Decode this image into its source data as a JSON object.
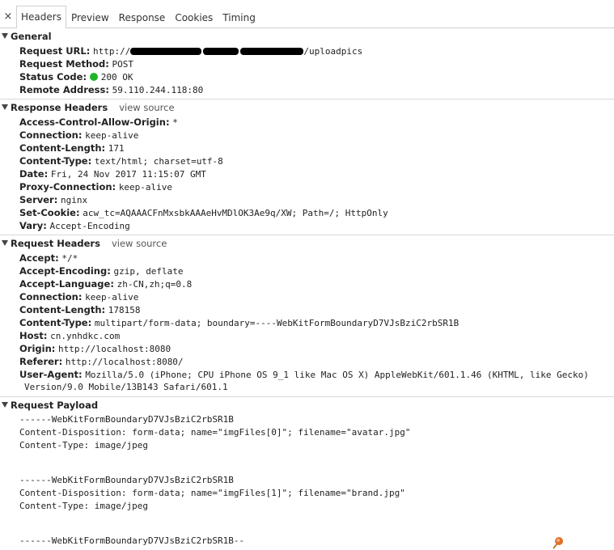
{
  "tabs": {
    "close": "×",
    "items": [
      "Headers",
      "Preview",
      "Response",
      "Cookies",
      "Timing"
    ]
  },
  "general": {
    "title": "General",
    "request_url_key": "Request URL:",
    "request_url_prefix": "http://",
    "request_url_suffix": "/uploadpics",
    "request_method_key": "Request Method:",
    "request_method": "POST",
    "status_code_key": "Status Code:",
    "status_code": "200 OK",
    "status_color": "#1db62a",
    "remote_address_key": "Remote Address:",
    "remote_address": "59.110.244.118:80"
  },
  "response_headers": {
    "title": "Response Headers",
    "view_source": "view source",
    "rows": [
      {
        "k": "Access-Control-Allow-Origin:",
        "v": "*"
      },
      {
        "k": "Connection:",
        "v": "keep-alive"
      },
      {
        "k": "Content-Length:",
        "v": "171"
      },
      {
        "k": "Content-Type:",
        "v": "text/html; charset=utf-8"
      },
      {
        "k": "Date:",
        "v": "Fri, 24 Nov 2017 11:15:07 GMT"
      },
      {
        "k": "Proxy-Connection:",
        "v": "keep-alive"
      },
      {
        "k": "Server:",
        "v": "nginx"
      },
      {
        "k": "Set-Cookie:",
        "v": "acw_tc=AQAAACFnMxsbkAAAeHvMDlOK3Ae9q/XW; Path=/; HttpOnly"
      },
      {
        "k": "Vary:",
        "v": "Accept-Encoding"
      }
    ]
  },
  "request_headers": {
    "title": "Request Headers",
    "view_source": "view source",
    "rows": [
      {
        "k": "Accept:",
        "v": "*/*"
      },
      {
        "k": "Accept-Encoding:",
        "v": "gzip, deflate"
      },
      {
        "k": "Accept-Language:",
        "v": "zh-CN,zh;q=0.8"
      },
      {
        "k": "Connection:",
        "v": "keep-alive"
      },
      {
        "k": "Content-Length:",
        "v": "178158"
      },
      {
        "k": "Content-Type:",
        "v": "multipart/form-data; boundary=----WebKitFormBoundaryD7VJsBziC2rbSR1B"
      },
      {
        "k": "Host:",
        "v": "cn.ynhdkc.com"
      },
      {
        "k": "Origin:",
        "v": "http://localhost:8080"
      },
      {
        "k": "Referer:",
        "v": "http://localhost:8080/"
      },
      {
        "k": "User-Agent:",
        "v": "Mozilla/5.0 (iPhone; CPU iPhone OS 9_1 like Mac OS X) AppleWebKit/601.1.46 (KHTML, like Gecko)"
      }
    ],
    "user_agent_cont": "Version/9.0 Mobile/13B143 Safari/601.1"
  },
  "payload": {
    "title": "Request Payload",
    "part1": {
      "boundary": "------WebKitFormBoundaryD7VJsBziC2rbSR1B",
      "disposition": "Content-Disposition: form-data; name=\"imgFiles[0]\"; filename=\"avatar.jpg\"",
      "type": "Content-Type: image/jpeg"
    },
    "part2": {
      "boundary": "------WebKitFormBoundaryD7VJsBziC2rbSR1B",
      "disposition": "Content-Disposition: form-data; name=\"imgFiles[1]\"; filename=\"brand.jpg\"",
      "type": "Content-Type: image/jpeg"
    },
    "end": "------WebKitFormBoundaryD7VJsBziC2rbSR1B--"
  },
  "pin_icon": "pushpin-icon"
}
